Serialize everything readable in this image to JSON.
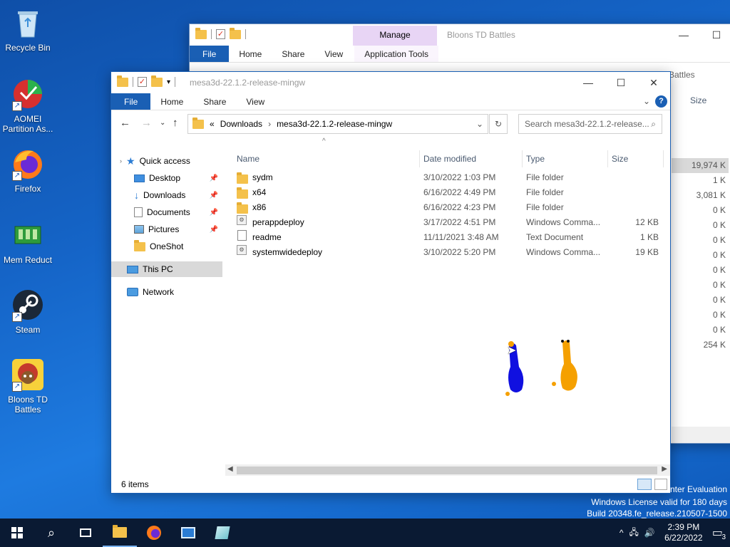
{
  "desktop": {
    "icons": [
      {
        "label": "Recycle Bin"
      },
      {
        "label": "AOMEI Partition As..."
      },
      {
        "label": "Firefox"
      },
      {
        "label": "Mem Reduct"
      },
      {
        "label": "Steam"
      },
      {
        "label": "Bloons TD Battles"
      }
    ]
  },
  "back_window": {
    "title": "Bloons TD Battles",
    "context_tab_group": "Manage",
    "tabs": [
      "File",
      "Home",
      "Share",
      "View",
      "Application Tools"
    ],
    "search_fragment": "Battles",
    "size_header": "Size",
    "sizes": [
      "19,974 K",
      "1 K",
      "3,081 K",
      "0 K",
      "0 K",
      "0 K",
      "0 K",
      "0 K",
      "0 K",
      "0 K",
      "0 K",
      "0 K",
      "254 K"
    ]
  },
  "window": {
    "title": "mesa3d-22.1.2-release-mingw",
    "tabs": [
      "File",
      "Home",
      "Share",
      "View"
    ],
    "address": {
      "overflow": "«",
      "crumbs": [
        "Downloads",
        "mesa3d-22.1.2-release-mingw"
      ]
    },
    "search_placeholder": "Search mesa3d-22.1.2-release...",
    "nav": {
      "quick_access": "Quick access",
      "items": [
        "Desktop",
        "Downloads",
        "Documents",
        "Pictures",
        "OneShot"
      ],
      "this_pc": "This PC",
      "network": "Network"
    },
    "columns": {
      "name": "Name",
      "date": "Date modified",
      "type": "Type",
      "size": "Size"
    },
    "files": [
      {
        "name": "sydm",
        "date": "3/10/2022 1:03 PM",
        "type": "File folder",
        "size": "",
        "kind": "folder"
      },
      {
        "name": "x64",
        "date": "6/16/2022 4:49 PM",
        "type": "File folder",
        "size": "",
        "kind": "folder"
      },
      {
        "name": "x86",
        "date": "6/16/2022 4:23 PM",
        "type": "File folder",
        "size": "",
        "kind": "folder"
      },
      {
        "name": "perappdeploy",
        "date": "3/17/2022 4:51 PM",
        "type": "Windows Comma...",
        "size": "12 KB",
        "kind": "cmd"
      },
      {
        "name": "readme",
        "date": "11/11/2021 3:48 AM",
        "type": "Text Document",
        "size": "1 KB",
        "kind": "txt"
      },
      {
        "name": "systemwidedeploy",
        "date": "3/10/2022 5:20 PM",
        "type": "Windows Comma...",
        "size": "19 KB",
        "kind": "cmd"
      }
    ],
    "status": "6 items"
  },
  "watermark": {
    "line1": "nter Evaluation",
    "line2": "Windows License valid for 180 days",
    "line3": "Build 20348.fe_release.210507-1500"
  },
  "taskbar": {
    "time": "2:39 PM",
    "date": "6/22/2022",
    "notifications": "3"
  },
  "colors": {
    "accent": "#1a5fb4",
    "manage_tab": "#e8d5f5",
    "figure_blue": "#1010e0",
    "figure_orange": "#f5a000"
  }
}
